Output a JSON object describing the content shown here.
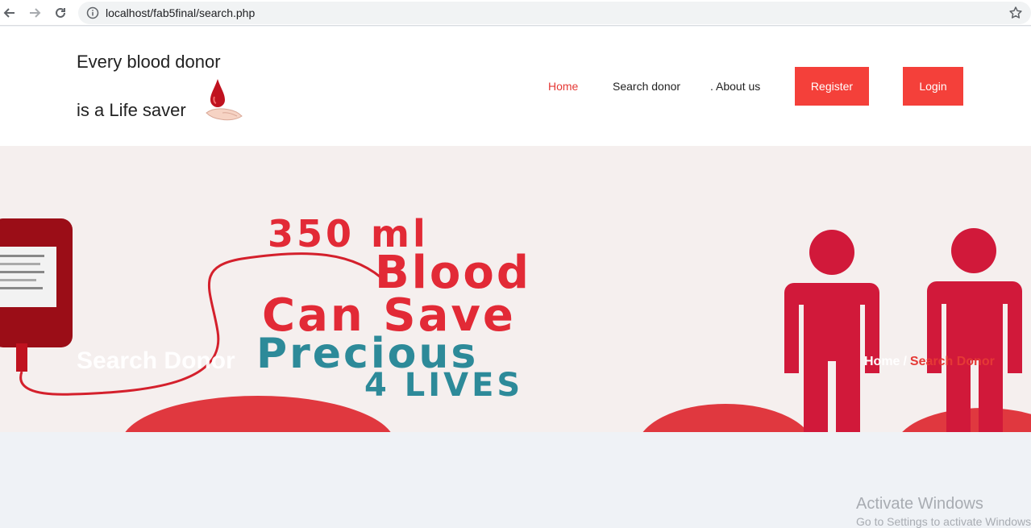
{
  "browser": {
    "url": "localhost/fab5final/search.php"
  },
  "brand": {
    "line1": "Every blood donor",
    "line2": "is a Life saver"
  },
  "nav": {
    "home": "Home",
    "search": "Search donor",
    "about": ". About us",
    "register": "Register",
    "login": "Login"
  },
  "banner": {
    "title": "Search Donor",
    "poster": {
      "line1": "350 ml",
      "line2": "Blood",
      "line3": "Can Save",
      "line4": "Precious",
      "line5": "4 LIVES"
    },
    "breadcrumb": {
      "home": "Home",
      "separator": "/",
      "current": "Search Donor"
    }
  },
  "watermark": {
    "line1": "Activate Windows",
    "line2": "Go to Settings to activate Windows."
  },
  "colors": {
    "accent_red": "#f4403a",
    "active_link": "#e53935",
    "poster_teal": "#2d8a99",
    "page_bg": "#eff2f6"
  }
}
